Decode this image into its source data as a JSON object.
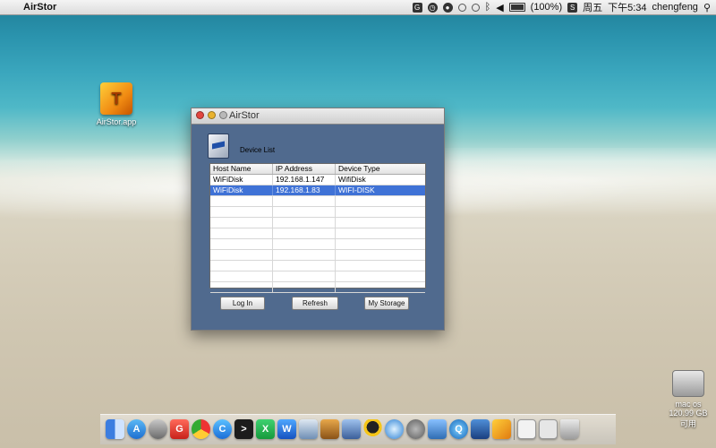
{
  "menubar": {
    "app_name": "AirStor",
    "battery_text": "(100%)",
    "day": "周五",
    "time": "下午5:34",
    "user": "chengfeng",
    "status_icons": [
      "sync-icon",
      "clock-icon",
      "shield-icon",
      "wifi-icon",
      "timemachine-icon",
      "bluetooth-icon",
      "volume-icon",
      "battery-icon",
      "input-s-icon",
      "search-icon"
    ]
  },
  "desktop": {
    "app_icon_label": "AirStor.app",
    "hd_label": "mac os",
    "hd_sublabel": "120.99 GB 可用"
  },
  "window": {
    "title": "AirStor",
    "section_label": "Device List",
    "columns": [
      "Host Name",
      "IP Address",
      "Device Type"
    ],
    "rows": [
      {
        "host": "WiFiDisk",
        "ip": "192.168.1.147",
        "type": "WifiDisk",
        "selected": false
      },
      {
        "host": "WiFiDisk",
        "ip": "192.168.1.83",
        "type": "WIFI-DISK",
        "selected": true
      }
    ],
    "buttons": {
      "login": "Log In",
      "refresh": "Refresh",
      "storage": "My Storage"
    }
  },
  "dock": {
    "apps": [
      "finder-icon",
      "appstore-icon",
      "launchpad-icon",
      "app-g-icon",
      "chrome-icon",
      "app-c-icon",
      "terminal-icon",
      "excel-icon",
      "word-icon",
      "preview-icon",
      "boxes-icon",
      "xcode-icon",
      "qq-icon",
      "safari-icon",
      "system-prefs-icon",
      "photo-icon",
      "quicktime-icon",
      "app-blue-icon",
      "airstor-icon",
      "divider",
      "window-thumb-icon",
      "window-thumb2-icon",
      "trash-icon"
    ]
  }
}
